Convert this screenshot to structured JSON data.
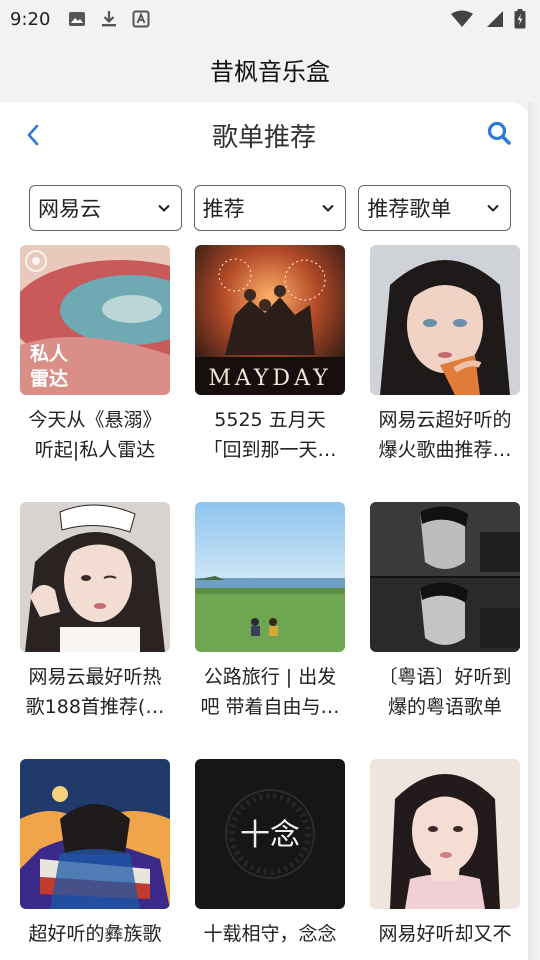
{
  "status_bar": {
    "time": "9:20",
    "left_icons": [
      "image-icon",
      "download-icon",
      "font-icon"
    ],
    "right_icons": [
      "wifi-icon",
      "signal-icon",
      "battery-icon"
    ]
  },
  "app": {
    "title": "昔枫音乐盒"
  },
  "header": {
    "title": "歌单推荐",
    "back_icon": "chevron-left-icon",
    "search_icon": "search-icon",
    "accent": "#2a7ad3"
  },
  "filters": [
    {
      "value": "网易云"
    },
    {
      "value": "推荐"
    },
    {
      "value": "推荐歌单"
    }
  ],
  "playlists": [
    {
      "line1": "今天从《悬溺》",
      "line2": "听起|私人雷达",
      "cover_text": "私人\n雷达"
    },
    {
      "line1": "5525 五月天",
      "line2": "「回到那一天…",
      "cover_text": "MAYDAY"
    },
    {
      "line1": "网易云超好听的",
      "line2": "爆火歌曲推荐…",
      "cover_text": ""
    },
    {
      "line1": "网易云最好听热",
      "line2": "歌188首推荐(…",
      "cover_text": ""
    },
    {
      "line1": "公路旅行 | 出发",
      "line2": "吧 带着自由与…",
      "cover_text": ""
    },
    {
      "line1": "〔粤语〕好听到",
      "line2": "爆的粤语歌单",
      "cover_text": ""
    },
    {
      "line1": "超好听的彝族歌",
      "line2": "",
      "cover_text": ""
    },
    {
      "line1": "十载相守，念念",
      "line2": "",
      "cover_text": "十念"
    },
    {
      "line1": "网易好听却又不",
      "line2": "",
      "cover_text": ""
    }
  ]
}
